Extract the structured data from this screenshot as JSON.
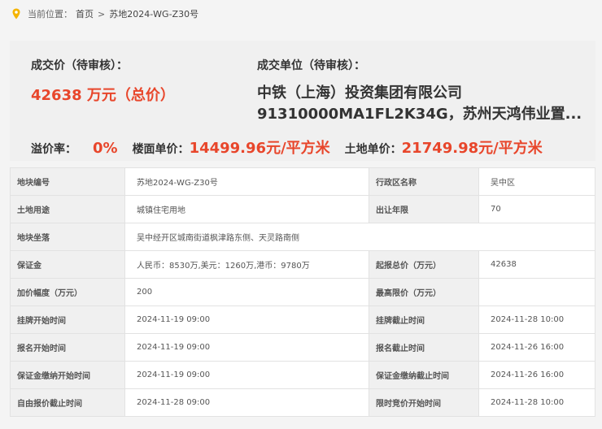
{
  "breadcrumb": {
    "prefix": "当前位置：",
    "home": "首页",
    "separator": ">",
    "current": "苏地2024-WG-Z30号"
  },
  "summary": {
    "price_label": "成交价（待审核）：",
    "price_value": "42638 万元（总价）",
    "buyer_label": "成交单位（待审核）：",
    "buyer_line1": "中铁（上海）投资集团有限公司",
    "buyer_line2": "91310000MA1FL2K34G，苏州天鸿伟业置...",
    "premium_label": "溢价率：",
    "premium_value": "0%",
    "floor_price_label": "楼面单价：",
    "floor_price_value": "14499.96元/平方米",
    "land_price_label": "土地单价：",
    "land_price_value": "21749.98元/平方米"
  },
  "details": [
    {
      "k1": "地块编号",
      "v1": "苏地2024-WG-Z30号",
      "k2": "行政区名称",
      "v2": "吴中区"
    },
    {
      "k1": "土地用途",
      "v1": "城镇住宅用地",
      "k2": "出让年限",
      "v2": "70"
    },
    {
      "k1": "地块坐落",
      "v1": "吴中经开区城南街道枫津路东侧、天灵路南侧"
    },
    {
      "k1": "保证金",
      "v1": "人民币：8530万,美元：1260万,港币：9780万",
      "k2": "起报总价（万元）",
      "v2": "42638"
    },
    {
      "k1": "加价幅度（万元）",
      "v1": "200",
      "k2": "最高限价（万元）",
      "v2": ""
    },
    {
      "k1": "挂牌开始时间",
      "v1": "2024-11-19 09:00",
      "k2": "挂牌截止时间",
      "v2": "2024-11-28 10:00"
    },
    {
      "k1": "报名开始时间",
      "v1": "2024-11-19 09:00",
      "k2": "报名截止时间",
      "v2": "2024-11-26 16:00"
    },
    {
      "k1": "保证金缴纳开始时间",
      "v1": "2024-11-19 09:00",
      "k2": "保证金缴纳截止时间",
      "v2": "2024-11-26 16:00"
    },
    {
      "k1": "自由报价截止时间",
      "v1": "2024-11-28 09:00",
      "k2": "限时竞价开始时间",
      "v2": "2024-11-28 10:00"
    }
  ],
  "icons": {
    "location": "location-pin-icon"
  },
  "colors": {
    "accent": "#e8462b",
    "pin": "#f5b400"
  }
}
